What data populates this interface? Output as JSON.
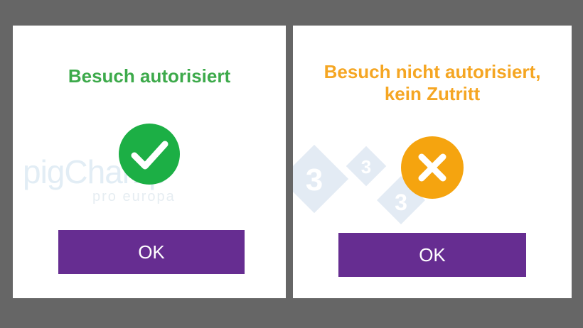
{
  "success_dialog": {
    "title": "Besuch autorisiert",
    "button_label": "OK",
    "icon": "checkmark-icon",
    "accent_color": "#1caf45"
  },
  "error_dialog": {
    "title_line1": "Besuch nicht autorisiert,",
    "title_line2": "kein Zutritt",
    "button_label": "OK",
    "icon": "x-icon",
    "accent_color": "#f5a40f"
  },
  "watermark": {
    "brand": "pigChamp",
    "subtitle": "pro europa",
    "mark": "3"
  },
  "colors": {
    "background": "#666666",
    "panel": "#ffffff",
    "button": "#662d91",
    "success_text": "#3daa4b",
    "error_text": "#f5a623"
  }
}
